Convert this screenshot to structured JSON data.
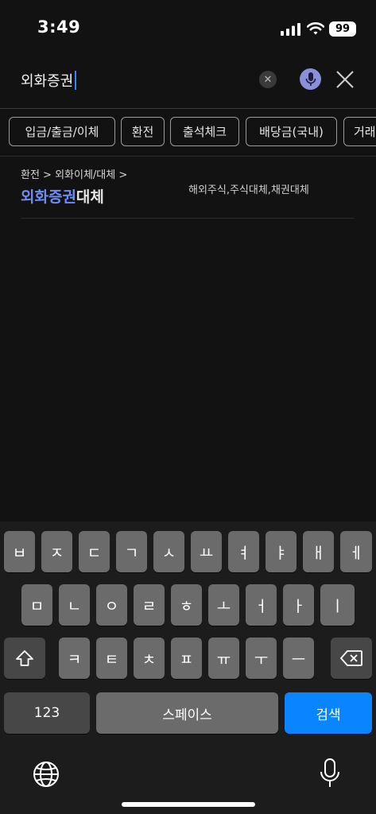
{
  "status_bar": {
    "time": "3:49",
    "battery": "99"
  },
  "search": {
    "value": "외화증권"
  },
  "chips": [
    "입금/출금/이체",
    "환전",
    "출석체크",
    "배당금(국내)",
    "거래"
  ],
  "result": {
    "breadcrumb": "환전 > 외화이체/대체 >",
    "title_highlight": "외화증권",
    "title_rest": "대체",
    "subtitle": "해외주식,주식대체,채권대체"
  },
  "keyboard": {
    "row1": [
      "ㅂ",
      "ㅈ",
      "ㄷ",
      "ㄱ",
      "ㅅ",
      "ㅛ",
      "ㅕ",
      "ㅑ",
      "ㅐ",
      "ㅔ"
    ],
    "row2": [
      "ㅁ",
      "ㄴ",
      "ㅇ",
      "ㄹ",
      "ㅎ",
      "ㅗ",
      "ㅓ",
      "ㅏ",
      "ㅣ"
    ],
    "row3": [
      "ㅋ",
      "ㅌ",
      "ㅊ",
      "ㅍ",
      "ㅠ",
      "ㅜ",
      "ㅡ"
    ],
    "numbers_label": "123",
    "space_label": "스페이스",
    "search_label": "검색"
  },
  "colors": {
    "accent": "#0a84ff",
    "highlight": "#6f8cf5",
    "mic": "#8b8fd8"
  }
}
